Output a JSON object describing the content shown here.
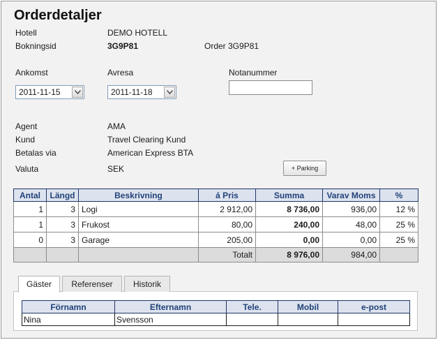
{
  "page": {
    "title": "Orderdetaljer"
  },
  "info": {
    "hotel_label": "Hotell",
    "hotel_value": "DEMO HOTELL",
    "booking_label": "Bokningsid",
    "booking_value": "3G9P81",
    "order_text": "Order 3G9P81"
  },
  "dates": {
    "arrival_label": "Ankomst",
    "arrival_value": "2011-11-15",
    "departure_label": "Avresa",
    "departure_value": "2011-11-18",
    "note_label": "Notanummer",
    "note_value": ""
  },
  "details": {
    "agent_label": "Agent",
    "agent_value": "AMA",
    "customer_label": "Kund",
    "customer_value": "Travel Clearing Kund",
    "paid_via_label": "Betalas via",
    "paid_via_value": "American Express BTA",
    "currency_label": "Valuta",
    "currency_value": "SEK",
    "parking_button": "+ Parking"
  },
  "order_table": {
    "headers": [
      "Antal",
      "Längd",
      "Beskrivning",
      "á Pris",
      "Summa",
      "Varav Moms",
      "%"
    ],
    "rows": [
      {
        "antal": "1",
        "langd": "3",
        "beskrivning": "Logi",
        "pris": "2 912,00",
        "summa": "8 736,00",
        "moms": "936,00",
        "procent": "12 %"
      },
      {
        "antal": "1",
        "langd": "3",
        "beskrivning": "Frukost",
        "pris": "80,00",
        "summa": "240,00",
        "moms": "48,00",
        "procent": "25 %"
      },
      {
        "antal": "0",
        "langd": "3",
        "beskrivning": "Garage",
        "pris": "205,00",
        "summa": "0,00",
        "moms": "0,00",
        "procent": "25 %"
      }
    ],
    "total": {
      "label": "Totalt",
      "summa": "8 976,00",
      "moms": "984,00"
    }
  },
  "tabs": [
    {
      "label": "Gäster",
      "active": true
    },
    {
      "label": "Referenser",
      "active": false
    },
    {
      "label": "Historik",
      "active": false
    }
  ],
  "guest_table": {
    "headers": [
      "Förnamn",
      "Efternamn",
      "Tele.",
      "Mobil",
      "e-post"
    ],
    "rows": [
      {
        "fornamn": "Nina",
        "efternamn": "Svensson",
        "tele": "",
        "mobil": "",
        "epost": ""
      }
    ]
  }
}
